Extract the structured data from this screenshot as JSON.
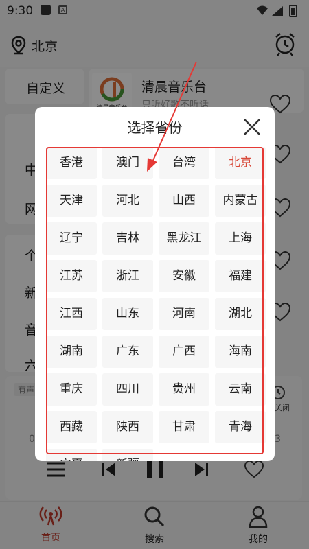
{
  "status_bar": {
    "time": "9:30",
    "notif_letter": "A"
  },
  "header": {
    "location": "北京"
  },
  "background": {
    "tab_custom": "自定义",
    "station_title": "清晨音乐台",
    "station_subtitle": "只听好歌不听话",
    "station_logo_text": "清晨音乐台",
    "left_col": [
      "中",
      "网",
      "个",
      "新",
      "音",
      "六"
    ],
    "player_tag": "有声",
    "player_right": "关闭",
    "time_left": "0",
    "time_right": "3"
  },
  "dialog": {
    "title": "选择省份",
    "selected": "北京",
    "provinces": [
      "香港",
      "澳门",
      "台湾",
      "北京",
      "天津",
      "河北",
      "山西",
      "内蒙古",
      "辽宁",
      "吉林",
      "黑龙江",
      "上海",
      "江苏",
      "浙江",
      "安徽",
      "福建",
      "江西",
      "山东",
      "河南",
      "湖北",
      "湖南",
      "广东",
      "广西",
      "海南",
      "重庆",
      "四川",
      "贵州",
      "云南",
      "西藏",
      "陕西",
      "甘肃",
      "青海",
      "宁夏",
      "新疆"
    ]
  },
  "bottom_nav": [
    {
      "label": "首页",
      "active": true
    },
    {
      "label": "搜索",
      "active": false
    },
    {
      "label": "我的",
      "active": false
    }
  ],
  "colors": {
    "accent": "#c0392b",
    "selected_text": "#d84a3a",
    "highlight_box": "#e53935"
  }
}
